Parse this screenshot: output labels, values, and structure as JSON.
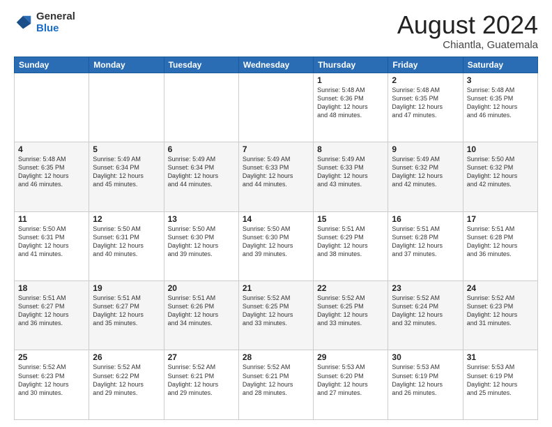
{
  "logo": {
    "general": "General",
    "blue": "Blue"
  },
  "header": {
    "month_year": "August 2024",
    "location": "Chiantla, Guatemala"
  },
  "weekdays": [
    "Sunday",
    "Monday",
    "Tuesday",
    "Wednesday",
    "Thursday",
    "Friday",
    "Saturday"
  ],
  "weeks": [
    [
      {
        "day": "",
        "info": ""
      },
      {
        "day": "",
        "info": ""
      },
      {
        "day": "",
        "info": ""
      },
      {
        "day": "",
        "info": ""
      },
      {
        "day": "1",
        "info": "Sunrise: 5:48 AM\nSunset: 6:36 PM\nDaylight: 12 hours\nand 48 minutes."
      },
      {
        "day": "2",
        "info": "Sunrise: 5:48 AM\nSunset: 6:35 PM\nDaylight: 12 hours\nand 47 minutes."
      },
      {
        "day": "3",
        "info": "Sunrise: 5:48 AM\nSunset: 6:35 PM\nDaylight: 12 hours\nand 46 minutes."
      }
    ],
    [
      {
        "day": "4",
        "info": "Sunrise: 5:48 AM\nSunset: 6:35 PM\nDaylight: 12 hours\nand 46 minutes."
      },
      {
        "day": "5",
        "info": "Sunrise: 5:49 AM\nSunset: 6:34 PM\nDaylight: 12 hours\nand 45 minutes."
      },
      {
        "day": "6",
        "info": "Sunrise: 5:49 AM\nSunset: 6:34 PM\nDaylight: 12 hours\nand 44 minutes."
      },
      {
        "day": "7",
        "info": "Sunrise: 5:49 AM\nSunset: 6:33 PM\nDaylight: 12 hours\nand 44 minutes."
      },
      {
        "day": "8",
        "info": "Sunrise: 5:49 AM\nSunset: 6:33 PM\nDaylight: 12 hours\nand 43 minutes."
      },
      {
        "day": "9",
        "info": "Sunrise: 5:49 AM\nSunset: 6:32 PM\nDaylight: 12 hours\nand 42 minutes."
      },
      {
        "day": "10",
        "info": "Sunrise: 5:50 AM\nSunset: 6:32 PM\nDaylight: 12 hours\nand 42 minutes."
      }
    ],
    [
      {
        "day": "11",
        "info": "Sunrise: 5:50 AM\nSunset: 6:31 PM\nDaylight: 12 hours\nand 41 minutes."
      },
      {
        "day": "12",
        "info": "Sunrise: 5:50 AM\nSunset: 6:31 PM\nDaylight: 12 hours\nand 40 minutes."
      },
      {
        "day": "13",
        "info": "Sunrise: 5:50 AM\nSunset: 6:30 PM\nDaylight: 12 hours\nand 39 minutes."
      },
      {
        "day": "14",
        "info": "Sunrise: 5:50 AM\nSunset: 6:30 PM\nDaylight: 12 hours\nand 39 minutes."
      },
      {
        "day": "15",
        "info": "Sunrise: 5:51 AM\nSunset: 6:29 PM\nDaylight: 12 hours\nand 38 minutes."
      },
      {
        "day": "16",
        "info": "Sunrise: 5:51 AM\nSunset: 6:28 PM\nDaylight: 12 hours\nand 37 minutes."
      },
      {
        "day": "17",
        "info": "Sunrise: 5:51 AM\nSunset: 6:28 PM\nDaylight: 12 hours\nand 36 minutes."
      }
    ],
    [
      {
        "day": "18",
        "info": "Sunrise: 5:51 AM\nSunset: 6:27 PM\nDaylight: 12 hours\nand 36 minutes."
      },
      {
        "day": "19",
        "info": "Sunrise: 5:51 AM\nSunset: 6:27 PM\nDaylight: 12 hours\nand 35 minutes."
      },
      {
        "day": "20",
        "info": "Sunrise: 5:51 AM\nSunset: 6:26 PM\nDaylight: 12 hours\nand 34 minutes."
      },
      {
        "day": "21",
        "info": "Sunrise: 5:52 AM\nSunset: 6:25 PM\nDaylight: 12 hours\nand 33 minutes."
      },
      {
        "day": "22",
        "info": "Sunrise: 5:52 AM\nSunset: 6:25 PM\nDaylight: 12 hours\nand 33 minutes."
      },
      {
        "day": "23",
        "info": "Sunrise: 5:52 AM\nSunset: 6:24 PM\nDaylight: 12 hours\nand 32 minutes."
      },
      {
        "day": "24",
        "info": "Sunrise: 5:52 AM\nSunset: 6:23 PM\nDaylight: 12 hours\nand 31 minutes."
      }
    ],
    [
      {
        "day": "25",
        "info": "Sunrise: 5:52 AM\nSunset: 6:23 PM\nDaylight: 12 hours\nand 30 minutes."
      },
      {
        "day": "26",
        "info": "Sunrise: 5:52 AM\nSunset: 6:22 PM\nDaylight: 12 hours\nand 29 minutes."
      },
      {
        "day": "27",
        "info": "Sunrise: 5:52 AM\nSunset: 6:21 PM\nDaylight: 12 hours\nand 29 minutes."
      },
      {
        "day": "28",
        "info": "Sunrise: 5:52 AM\nSunset: 6:21 PM\nDaylight: 12 hours\nand 28 minutes."
      },
      {
        "day": "29",
        "info": "Sunrise: 5:53 AM\nSunset: 6:20 PM\nDaylight: 12 hours\nand 27 minutes."
      },
      {
        "day": "30",
        "info": "Sunrise: 5:53 AM\nSunset: 6:19 PM\nDaylight: 12 hours\nand 26 minutes."
      },
      {
        "day": "31",
        "info": "Sunrise: 5:53 AM\nSunset: 6:19 PM\nDaylight: 12 hours\nand 25 minutes."
      }
    ]
  ]
}
